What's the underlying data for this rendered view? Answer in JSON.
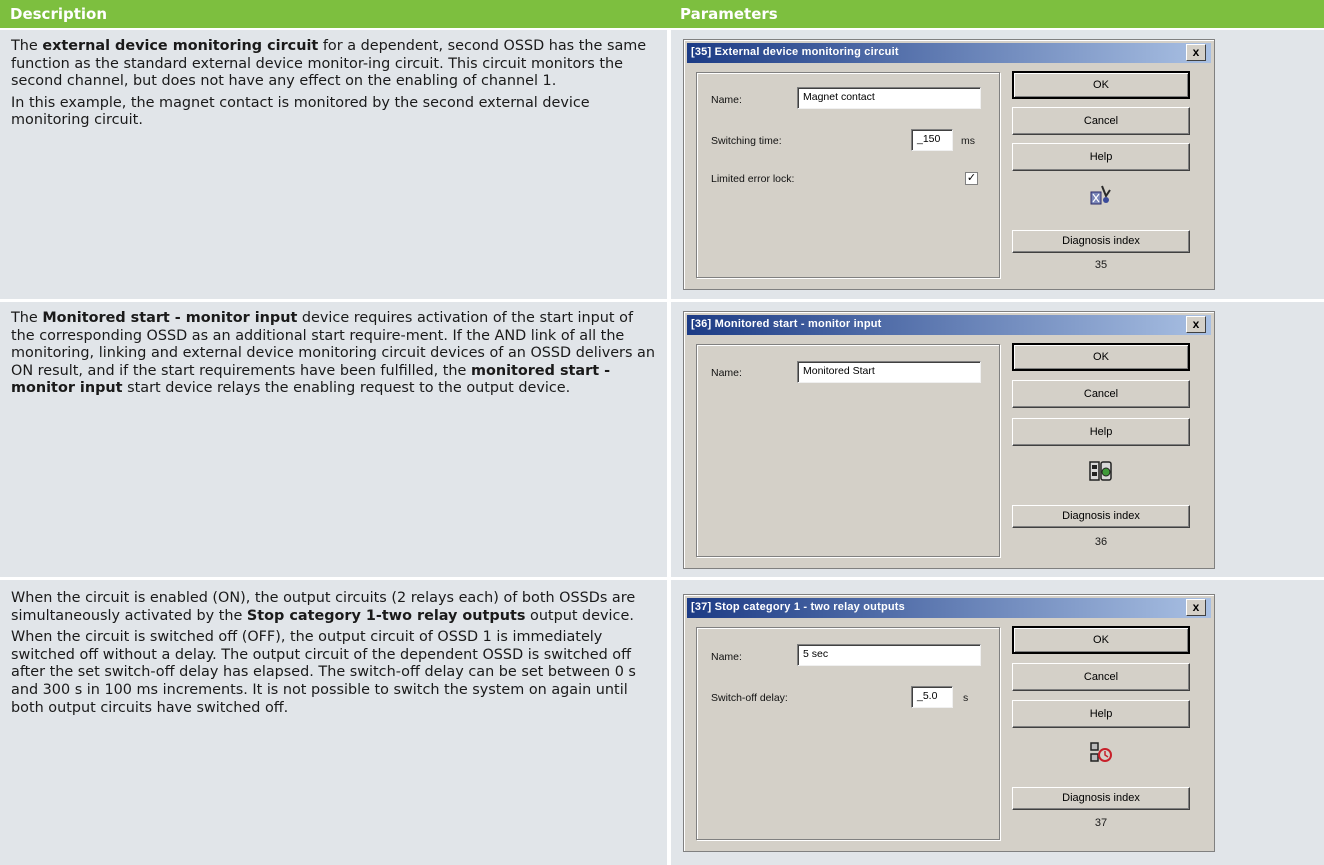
{
  "header": {
    "description": "Description",
    "parameters": "Parameters"
  },
  "rows": [
    {
      "desc_p1_a": "The ",
      "desc_p1_b": "external device monitoring circuit",
      "desc_p1_c": " for a dependent, second OSSD has the same function as the standard external device monitor-ing circuit. This circuit monitors the second channel, but does not have any effect on the enabling of channel 1.",
      "desc_p2": "In this example, the magnet contact is monitored by the second external device monitoring circuit.",
      "dialog": {
        "title": "[35] External device monitoring circuit",
        "close": "x",
        "name_label": "Name:",
        "name_value": "Magnet contact",
        "time_label": "Switching time:",
        "time_value": "_150",
        "time_unit": "ms",
        "lock_label": "Limited error lock:",
        "lock_checked": "✓",
        "ok": "OK",
        "cancel": "Cancel",
        "help": "Help",
        "icon": "device-monitoring-icon",
        "diag": "Diagnosis index",
        "index": "35"
      }
    },
    {
      "desc_a": "The ",
      "desc_b": "Monitored start - monitor input",
      "desc_c": " device requires activation of the start input of the corresponding OSSD as an additional start require-ment. If the AND link of all the monitoring, linking and external device monitoring circuit devices of an OSSD delivers an ON result, and if the start requirements have been fulfilled, the ",
      "desc_d": "monitored start - monitor input",
      "desc_e": " start device relays the enabling request to the output device.",
      "dialog": {
        "title": "[36] Monitored start - monitor input",
        "close": "x",
        "name_label": "Name:",
        "name_value": "Monitored Start",
        "ok": "OK",
        "cancel": "Cancel",
        "help": "Help",
        "icon": "start-button-icon",
        "diag": "Diagnosis index",
        "index": "36"
      }
    },
    {
      "desc_p1_a": "When the circuit is enabled (ON), the output circuits (2 relays each) of both OSSDs are simultaneously activated by the ",
      "desc_p1_b": "Stop category 1-two relay outputs",
      "desc_p1_c": " output device.",
      "desc_p2": "When the circuit is switched off (OFF), the output circuit of OSSD 1 is immediately switched off without a delay. The output circuit of the dependent OSSD is switched off after the set switch-off delay has elapsed. The switch-off delay can be set between 0 s and 300 s in 100 ms increments. It is not possible to switch the system on again until both output circuits have switched off.",
      "dialog": {
        "title": "[37] Stop category 1 - two relay outputs",
        "close": "x",
        "name_label": "Name:",
        "name_value": "5 sec",
        "delay_label": "Switch-off delay:",
        "delay_value": "_5.0",
        "delay_unit": "s",
        "ok": "OK",
        "cancel": "Cancel",
        "help": "Help",
        "icon": "relay-timer-icon",
        "diag": "Diagnosis index",
        "index": "37"
      }
    }
  ]
}
